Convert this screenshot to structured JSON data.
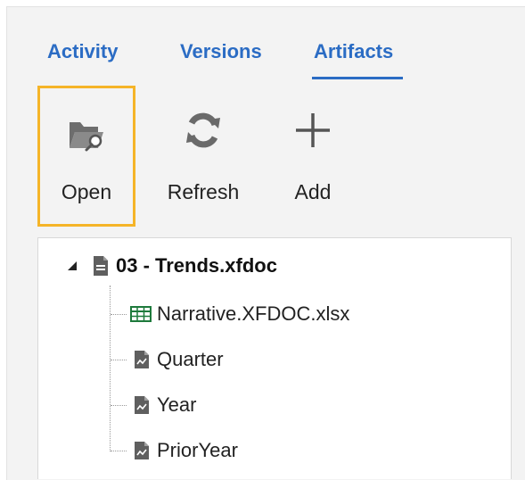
{
  "tabs": [
    {
      "label": "Activity",
      "active": false
    },
    {
      "label": "Versions",
      "active": false
    },
    {
      "label": "Artifacts",
      "active": true
    }
  ],
  "toolbar": {
    "open": {
      "label": "Open",
      "icon": "folder-search-icon"
    },
    "refresh": {
      "label": "Refresh",
      "icon": "refresh-icon"
    },
    "add": {
      "label": "Add",
      "icon": "plus-icon"
    }
  },
  "tree": {
    "root": {
      "label": "03 - Trends.xfdoc",
      "icon": "document-icon",
      "expanded": true
    },
    "children": [
      {
        "label": "Narrative.XFDOC.xlsx",
        "icon": "spreadsheet-icon"
      },
      {
        "label": "Quarter",
        "icon": "document-icon"
      },
      {
        "label": "Year",
        "icon": "document-icon"
      },
      {
        "label": "PriorYear",
        "icon": "document-icon"
      }
    ]
  },
  "colors": {
    "accent": "#2b6cc4",
    "selection_border": "#f5b428",
    "spreadsheet_green": "#1e7a3c"
  }
}
